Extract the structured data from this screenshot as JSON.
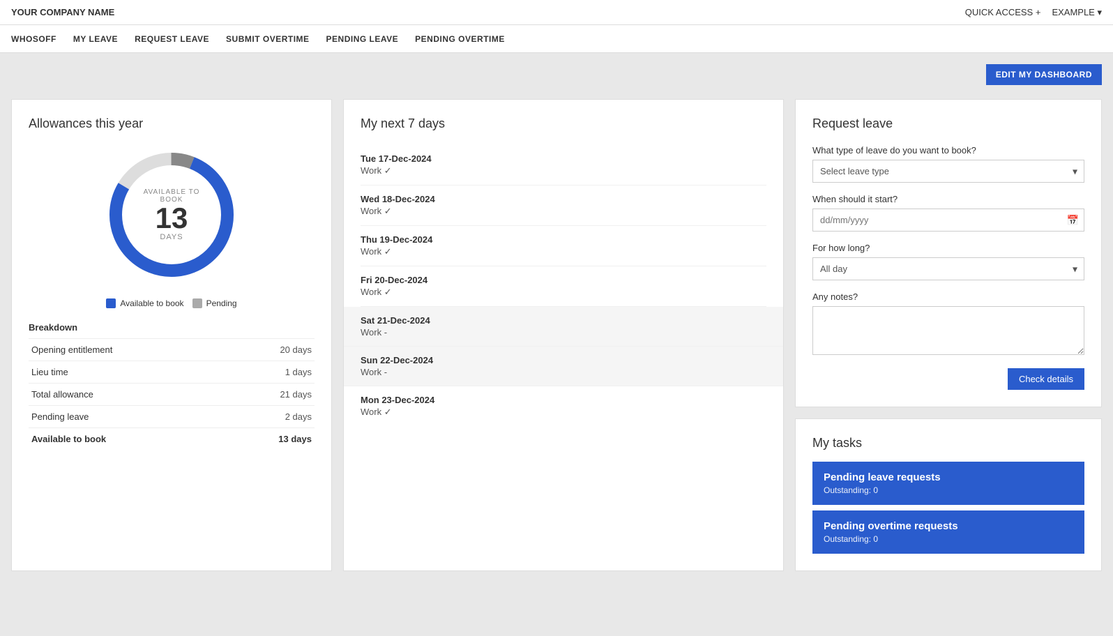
{
  "topBar": {
    "companyName": "YOUR COMPANY NAME",
    "quickAccess": "QUICK ACCESS +",
    "example": "EXAMPLE ▾"
  },
  "nav": {
    "items": [
      "WHOSOFF",
      "MY LEAVE",
      "REQUEST LEAVE",
      "SUBMIT OVERTIME",
      "PENDING LEAVE",
      "PENDING OVERTIME"
    ]
  },
  "editDashboard": "EDIT MY DASHBOARD",
  "allowances": {
    "title": "Allowances this year",
    "donut": {
      "label": "AVAILABLE TO BOOK",
      "number": "13",
      "unit": "DAYS"
    },
    "legend": [
      {
        "label": "Available to book",
        "color": "#2a5ccd"
      },
      {
        "label": "Pending",
        "color": "#aaa"
      }
    ],
    "breakdown": {
      "title": "Breakdown",
      "rows": [
        {
          "label": "Opening entitlement",
          "value": "20 days"
        },
        {
          "label": "Lieu time",
          "value": "1 days"
        },
        {
          "label": "Total allowance",
          "value": "21 days"
        },
        {
          "label": "Pending leave",
          "value": "2 days"
        },
        {
          "label": "Available to book",
          "value": "13 days"
        }
      ]
    }
  },
  "next7Days": {
    "title": "My next 7 days",
    "days": [
      {
        "date": "Tue 17-Dec-2024",
        "status": "Work ✓",
        "weekend": false
      },
      {
        "date": "Wed 18-Dec-2024",
        "status": "Work ✓",
        "weekend": false
      },
      {
        "date": "Thu 19-Dec-2024",
        "status": "Work ✓",
        "weekend": false
      },
      {
        "date": "Fri 20-Dec-2024",
        "status": "Work ✓",
        "weekend": false
      },
      {
        "date": "Sat 21-Dec-2024",
        "status": "Work -",
        "weekend": true
      },
      {
        "date": "Sun 22-Dec-2024",
        "status": "Work -",
        "weekend": true
      },
      {
        "date": "Mon 23-Dec-2024",
        "status": "Work ✓",
        "weekend": false
      }
    ]
  },
  "requestLeave": {
    "title": "Request leave",
    "leaveTypeLabel": "What type of leave do you want to book?",
    "leaveTypePlaceholder": "Select leave type",
    "startLabel": "When should it start?",
    "startPlaceholder": "dd/mm/yyyy",
    "durationLabel": "For how long?",
    "durationPlaceholder": "All day",
    "notesLabel": "Any notes?",
    "checkDetailsBtn": "Check details"
  },
  "myTasks": {
    "title": "My tasks",
    "tasks": [
      {
        "title": "Pending leave requests",
        "subtitle": "Outstanding: 0"
      },
      {
        "title": "Pending overtime requests",
        "subtitle": "Outstanding: 0"
      }
    ]
  }
}
